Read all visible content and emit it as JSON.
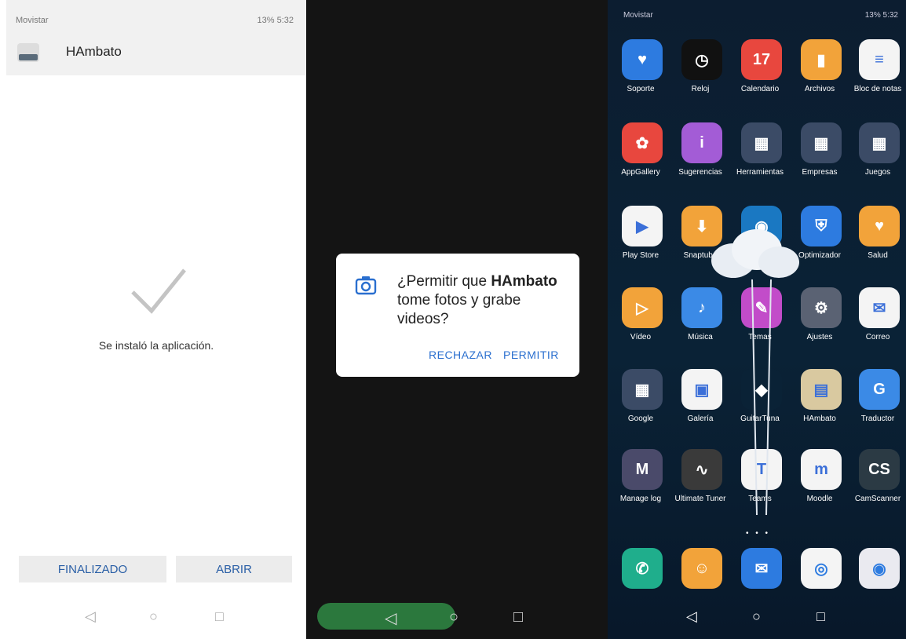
{
  "installer": {
    "status_left": "Movistar",
    "status_right": "13% 5:32",
    "app_title": "HAmbato",
    "message": "Se instaló la aplicación.",
    "btn_finish": "FINALIZADO",
    "btn_open": "ABRIR",
    "nav": {
      "back": "◁",
      "home": "○",
      "recent": "□"
    }
  },
  "permission": {
    "prefix": "¿Permitir que ",
    "app_name": "HAmbato",
    "suffix": " tome fotos y grabe videos?",
    "deny": "RECHAZAR",
    "allow": "PERMITIR",
    "nav": {
      "back": "◁",
      "home": "○",
      "recent": "□"
    }
  },
  "home": {
    "status_left": "Movistar",
    "status_right": "13% 5:32",
    "page_dots": "• • •",
    "apps": [
      {
        "label": "Soporte",
        "color": "#2d7be0",
        "glyph": "♥"
      },
      {
        "label": "Reloj",
        "color": "#111111",
        "glyph": "◷"
      },
      {
        "label": "Calendario",
        "color": "#e8473e",
        "glyph": "17"
      },
      {
        "label": "Archivos",
        "color": "#f2a33a",
        "glyph": "▮"
      },
      {
        "label": "Bloc de notas",
        "color": "#f4f4f4",
        "glyph": "≡"
      },
      {
        "label": "AppGallery",
        "color": "#e8473e",
        "glyph": "✿"
      },
      {
        "label": "Sugerencias",
        "color": "#a35cd6",
        "glyph": "i"
      },
      {
        "label": "Herramientas",
        "color": "#3b4b66",
        "glyph": "▦"
      },
      {
        "label": "Empresas",
        "color": "#3b4b66",
        "glyph": "▦"
      },
      {
        "label": "Juegos",
        "color": "#3b4b66",
        "glyph": "▦"
      },
      {
        "label": "Play Store",
        "color": "#f4f4f4",
        "glyph": "▶"
      },
      {
        "label": "Snaptube",
        "color": "#f2a33a",
        "glyph": "⬇"
      },
      {
        "label": "",
        "color": "#1a78c2",
        "glyph": "◉"
      },
      {
        "label": "Optimizador",
        "color": "#2d7be0",
        "glyph": "⛨"
      },
      {
        "label": "Salud",
        "color": "#f2a33a",
        "glyph": "♥"
      },
      {
        "label": "Vídeo",
        "color": "#f2a33a",
        "glyph": "▷"
      },
      {
        "label": "Música",
        "color": "#3b8ae6",
        "glyph": "♪"
      },
      {
        "label": "Temas",
        "color": "#c24cc9",
        "glyph": "✎"
      },
      {
        "label": "Ajustes",
        "color": "#5a6273",
        "glyph": "⚙"
      },
      {
        "label": "Correo",
        "color": "#f4f4f4",
        "glyph": "✉"
      },
      {
        "label": "Google",
        "color": "#3b4b66",
        "glyph": "▦"
      },
      {
        "label": "Galería",
        "color": "#f4f4f4",
        "glyph": "▣"
      },
      {
        "label": "GuitarTuna",
        "color": "#0a2236",
        "glyph": "◆"
      },
      {
        "label": "HAmbato",
        "color": "#d9c9a0",
        "glyph": "▤"
      },
      {
        "label": "Traductor",
        "color": "#3b8ae6",
        "glyph": "G"
      },
      {
        "label": "Manage log",
        "color": "#4a4a6a",
        "glyph": "M"
      },
      {
        "label": "Ultimate Tuner",
        "color": "#3a3a3a",
        "glyph": "∿"
      },
      {
        "label": "Teams",
        "color": "#f4f4f4",
        "glyph": "T"
      },
      {
        "label": "Moodle",
        "color": "#f4f4f4",
        "glyph": "m"
      },
      {
        "label": "CamScanner",
        "color": "#2b3a44",
        "glyph": "CS"
      }
    ],
    "dock": [
      {
        "label": "Teléfono",
        "color": "#1fae8c",
        "glyph": "✆"
      },
      {
        "label": "Contactos",
        "color": "#f2a33a",
        "glyph": "☺"
      },
      {
        "label": "Mensajes",
        "color": "#2d7be0",
        "glyph": "✉"
      },
      {
        "label": "Chrome",
        "color": "#f4f4f4",
        "glyph": "◎"
      },
      {
        "label": "Cámara",
        "color": "#eaeaf0",
        "glyph": "◉"
      }
    ],
    "nav": {
      "back": "◁",
      "home": "○",
      "recent": "□"
    }
  }
}
